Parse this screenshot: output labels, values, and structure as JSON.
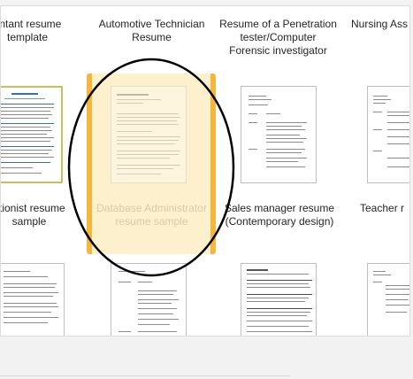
{
  "templates": {
    "row1": [
      {
        "title": "untant resume template"
      },
      {
        "title": "Automotive Technician Resume"
      },
      {
        "title": "Resume of a Penetration tester/Computer Forensic investigator"
      },
      {
        "title": "Nursing Ass"
      }
    ],
    "row2": [
      {
        "title": "otionist resume sample"
      },
      {
        "title": "Database Administrator resume sample"
      },
      {
        "title": "Sales manager resume (Contemporary design)"
      },
      {
        "title": "Teacher r"
      }
    ]
  },
  "selection": {
    "highlight_color": "#f4b63c",
    "annotation": "ellipse"
  }
}
